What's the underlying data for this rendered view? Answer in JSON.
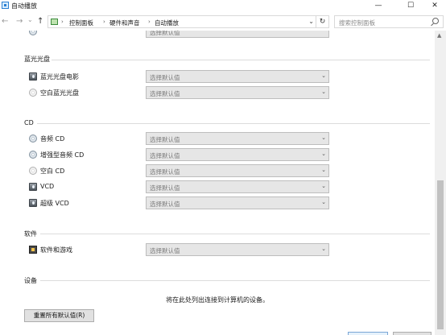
{
  "window": {
    "title": "自动播放",
    "minimize": "—",
    "maximize": "☐",
    "close": "✕"
  },
  "address": {
    "back": "←",
    "forward": "→",
    "history_dropdown": "⌄",
    "up": "↑",
    "crumbs": [
      "控制面板",
      "硬件和声音",
      "自动播放"
    ],
    "crumb_separator": "›",
    "dropdown_arrow": "⌄",
    "refresh": "↻",
    "search_placeholder": "搜索控制面板"
  },
  "scrollbar": {
    "up_arrow": "▲"
  },
  "partial_row": {
    "label": "",
    "value": "选择默认值"
  },
  "sections": [
    {
      "header": "蓝光光盘",
      "rows": [
        {
          "icon": "blu-ray-movie-icon",
          "label": "蓝光光盘电影",
          "value": "选择默认值"
        },
        {
          "icon": "blank-disc-icon",
          "label": "空白蓝光光盘",
          "value": "选择默认值"
        }
      ]
    },
    {
      "header": "CD",
      "rows": [
        {
          "icon": "audio-cd-icon",
          "label": "音频 CD",
          "value": "选择默认值"
        },
        {
          "icon": "enhanced-audio-cd-icon",
          "label": "增强型音频 CD",
          "value": "选择默认值"
        },
        {
          "icon": "blank-cd-icon",
          "label": "空白 CD",
          "value": "选择默认值"
        },
        {
          "icon": "vcd-icon",
          "label": "VCD",
          "value": "选择默认值"
        },
        {
          "icon": "svcd-icon",
          "label": "超级 VCD",
          "value": "选择默认值"
        }
      ]
    },
    {
      "header": "软件",
      "rows": [
        {
          "icon": "software-games-icon",
          "label": "软件和游戏",
          "value": "选择默认值"
        }
      ]
    },
    {
      "header": "设备",
      "rows": []
    }
  ],
  "select_chevron": "⌄",
  "devices_message": "将在此处列出连接到计算机的设备。",
  "reset_button": "重置所有默认值(R)"
}
